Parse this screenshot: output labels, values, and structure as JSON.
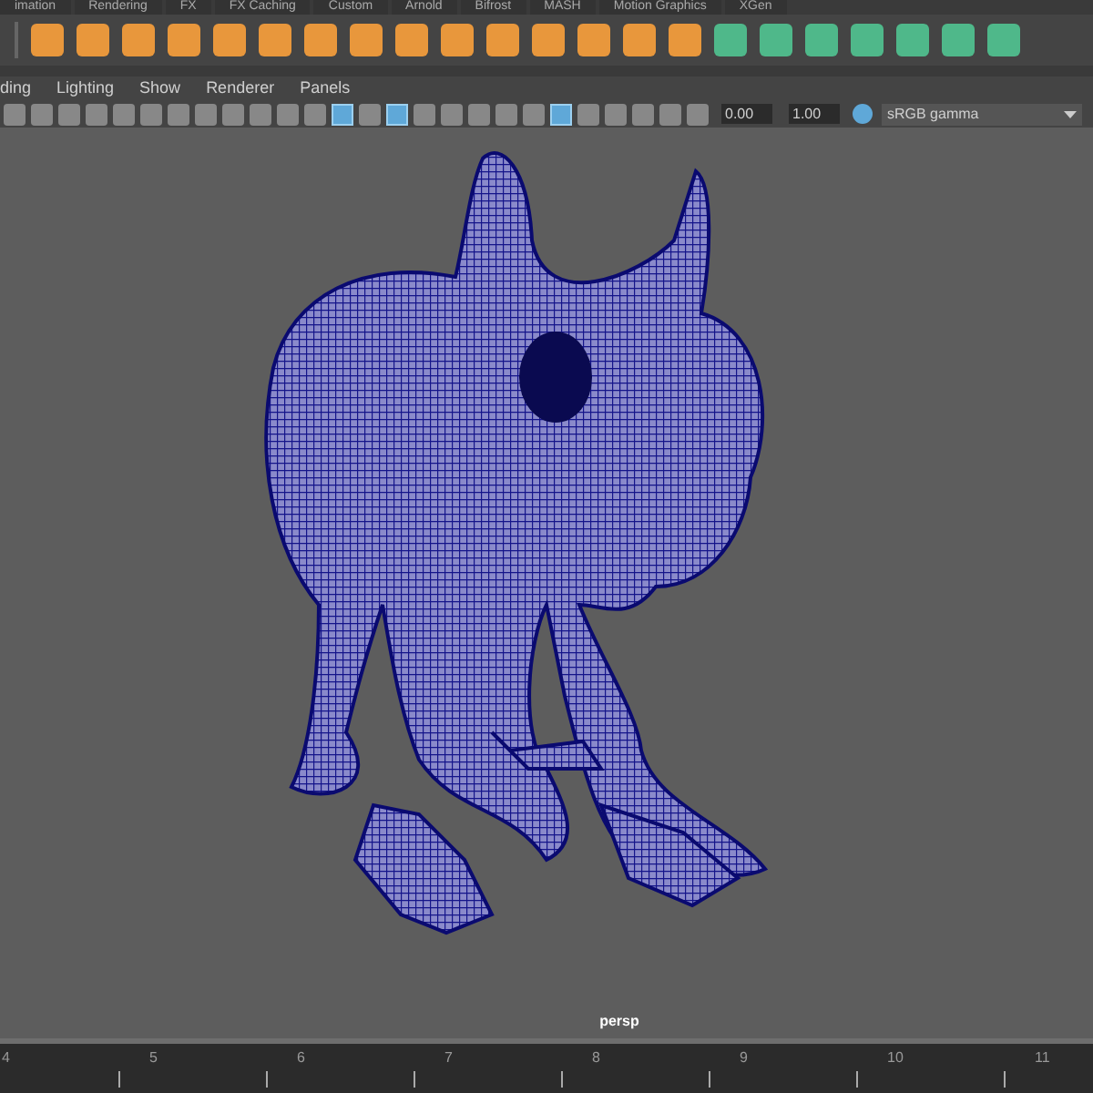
{
  "shelf_tabs": [
    {
      "label": "imation"
    },
    {
      "label": "Rendering"
    },
    {
      "label": "FX"
    },
    {
      "label": "FX Caching"
    },
    {
      "label": "Custom"
    },
    {
      "label": "Arnold"
    },
    {
      "label": "Bifrost"
    },
    {
      "label": "MASH"
    },
    {
      "label": "Motion Graphics"
    },
    {
      "label": "XGen"
    }
  ],
  "shelf_icons": [
    {
      "color": "#e8973c"
    },
    {
      "color": "#e8973c"
    },
    {
      "color": "#e8973c"
    },
    {
      "color": "#e8973c"
    },
    {
      "color": "#e8973c"
    },
    {
      "color": "#e8973c"
    },
    {
      "color": "#e8973c"
    },
    {
      "color": "#e8973c"
    },
    {
      "color": "#e8973c"
    },
    {
      "color": "#e8973c"
    },
    {
      "color": "#e8973c"
    },
    {
      "color": "#e8973c"
    },
    {
      "color": "#e8973c"
    },
    {
      "color": "#e8973c"
    },
    {
      "color": "#e8973c"
    },
    {
      "color": "#4fb88a"
    },
    {
      "color": "#4fb88a"
    },
    {
      "color": "#4fb88a"
    },
    {
      "color": "#4fb88a"
    },
    {
      "color": "#4fb88a"
    },
    {
      "color": "#4fb88a"
    },
    {
      "color": "#4fb88a"
    }
  ],
  "menu": [
    "ding",
    "Lighting",
    "Show",
    "Renderer",
    "Panels"
  ],
  "toolbar": [
    {
      "on": false
    },
    {
      "on": false
    },
    {
      "on": false
    },
    {
      "on": false
    },
    {
      "on": false
    },
    {
      "on": false
    },
    {
      "on": false
    },
    {
      "on": false
    },
    {
      "on": false
    },
    {
      "on": false
    },
    {
      "on": false
    },
    {
      "on": false
    },
    {
      "on": true
    },
    {
      "on": false
    },
    {
      "on": true
    },
    {
      "on": false
    },
    {
      "on": false
    },
    {
      "on": false
    },
    {
      "on": false
    },
    {
      "on": false
    },
    {
      "on": true
    },
    {
      "on": false
    },
    {
      "on": false
    },
    {
      "on": false
    },
    {
      "on": false
    },
    {
      "on": false
    }
  ],
  "exposure": "0.00",
  "gamma": "1.00",
  "color_space": "sRGB gamma",
  "viewport": {
    "camera": "persp"
  },
  "timeline": [
    "4",
    "5",
    "6",
    "7",
    "8",
    "9",
    "10",
    "11"
  ]
}
